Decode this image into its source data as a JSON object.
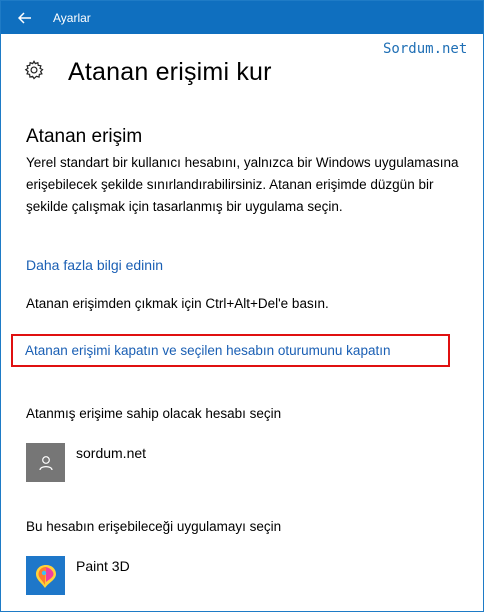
{
  "window": {
    "title": "Ayarlar"
  },
  "watermark": "Sordum.net",
  "page": {
    "title": "Atanan erişimi kur"
  },
  "section": {
    "title": "Atanan erişim",
    "description": "Yerel standart bir kullanıcı hesabını, yalnızca bir Windows uygulamasına erişebilecek şekilde sınırlandırabilirsiniz. Atanan erişimde düzgün bir şekilde çalışmak için tasarlanmış bir uygulama seçin.",
    "more_info_link": "Daha fazla bilgi edinin",
    "exit_hint": "Atanan erişimden çıkmak için Ctrl+Alt+Del'e basın.",
    "close_link": "Atanan erişimi kapatın ve seçilen hesabın oturumunu kapatın"
  },
  "account": {
    "label": "Atanmış erişime sahip olacak hesabı seçin",
    "name": "sordum.net",
    "icon": "user-icon"
  },
  "app": {
    "label": "Bu hesabın erişebileceği uygulamayı seçin",
    "name": "Paint 3D",
    "icon": "paint3d-icon"
  },
  "colors": {
    "titlebar": "#0f6fbf",
    "link": "#1a5fb4",
    "highlight": "#e01010",
    "avatar": "#767676",
    "app_tile": "#1e77c9"
  }
}
